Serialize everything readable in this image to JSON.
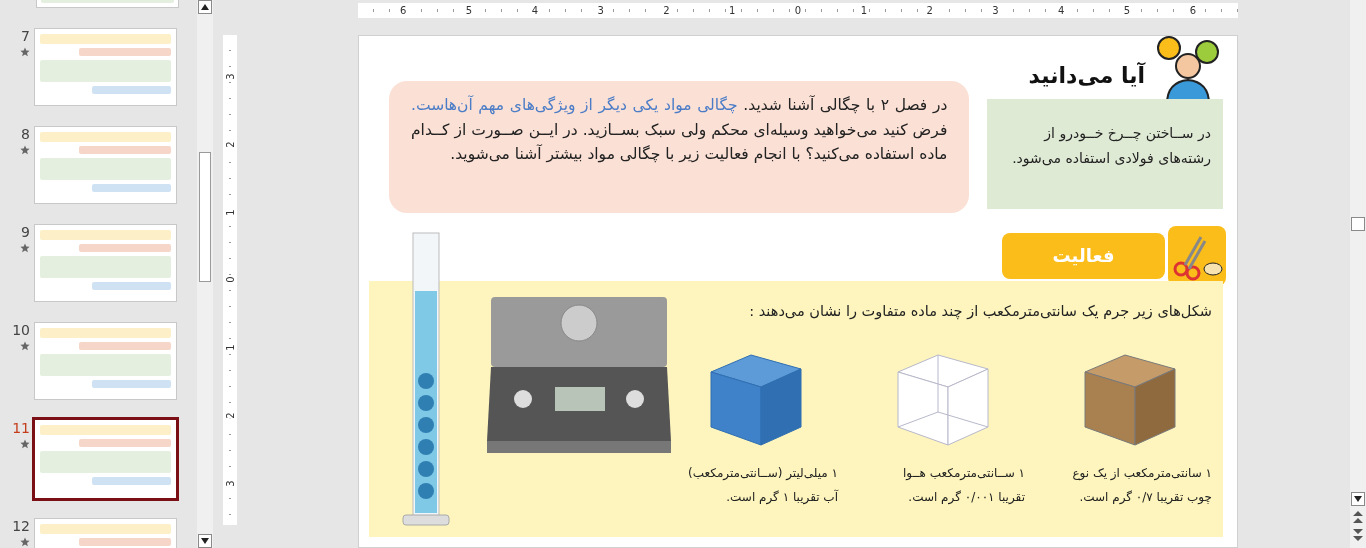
{
  "ruler_h": {
    "labels": [
      "6",
      "5",
      "4",
      "3",
      "2",
      "1",
      "0",
      "1",
      "2",
      "3",
      "4",
      "5",
      "6"
    ]
  },
  "ruler_v": {
    "labels": [
      "3",
      "2",
      "1",
      "0",
      "1",
      "2",
      "3"
    ]
  },
  "thumbnails": [
    {
      "number": "7",
      "selected": false
    },
    {
      "number": "8",
      "selected": false
    },
    {
      "number": "9",
      "selected": false
    },
    {
      "number": "10",
      "selected": false
    },
    {
      "number": "11",
      "selected": true
    },
    {
      "number": "12",
      "selected": false
    }
  ],
  "slide": {
    "title": "آیا می‌دانید",
    "fact": "در ســاختن چــرخ خــودرو از رشته‌های فولادی استفاده می‌شود.",
    "intro": [
      {
        "text": "در فصل ۲ با چگالی آشنا شدید. ",
        "highlight": false
      },
      {
        "text": "چگالی مواد یکی دیگر از ویژگی‌های مهم آن‌هاست.",
        "highlight": true
      },
      {
        "text": " فرض کنید می‌خواهید وسیله‌ای محکم ولی سبک بســازید. در ایــن صــورت از کــدام ماده استفاده می‌کنید؟ با انجام فعالیت زیر با چگالی مواد بیشتر آشنا می‌شوید.",
        "highlight": false
      }
    ],
    "activity": {
      "label": "فعالیت",
      "instruction": "شکل‌های زیر جرم یک سانتی‌مترمکعب از چند ماده متفاوت را نشان می‌دهند :",
      "items": [
        {
          "kind": "wood",
          "caption": [
            "۱ سانتی‌مترمکعب از یک نوع",
            "چوب تقریبا ۰/۷ گرم است."
          ]
        },
        {
          "kind": "air",
          "caption": [
            "۱ ســانتی‌مترمکعب هــوا",
            "تقریبا ۰/۰۰۱ گرم است."
          ]
        },
        {
          "kind": "water",
          "caption": [
            "۱ میلی‌لیتر (ســانتی‌مترمکعب)",
            "آب تقریبا ۱ گرم است."
          ]
        }
      ]
    }
  }
}
